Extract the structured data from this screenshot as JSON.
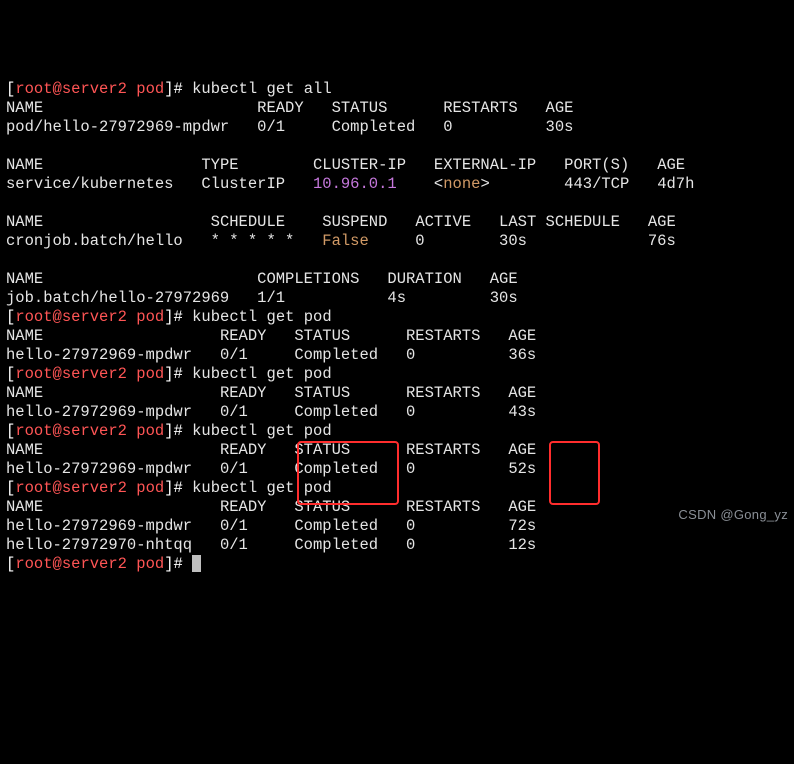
{
  "prompt": {
    "user": "root",
    "host": "server2",
    "cwd": "pod",
    "open": "[",
    "at": "@",
    "close": "]",
    "hash": "# "
  },
  "cmds": {
    "get_all": "kubectl get all",
    "get_pod": "kubectl get pod"
  },
  "hdrs": {
    "NAME": "NAME",
    "READY": "READY",
    "STATUS": "STATUS",
    "RESTARTS": "RESTARTS",
    "AGE": "AGE",
    "TYPE": "TYPE",
    "CLUSTER_IP": "CLUSTER-IP",
    "EXTERNAL_IP": "EXTERNAL-IP",
    "PORTS": "PORT(S)",
    "SCHEDULE": "SCHEDULE",
    "SUSPEND": "SUSPEND",
    "ACTIVE": "ACTIVE",
    "LAST_SCHEDULE": "LAST SCHEDULE",
    "COMPLETIONS": "COMPLETIONS",
    "DURATION": "DURATION"
  },
  "block1_pod": {
    "name": "pod/hello-27972969-mpdwr",
    "ready": "0/1",
    "status": "Completed",
    "restarts": "0",
    "age": "30s"
  },
  "svc": {
    "name": "service/kubernetes",
    "type": "ClusterIP",
    "cluster_ip": "10.96.0.1",
    "external_ip_open": "<",
    "external_ip_text": "none",
    "external_ip_close": ">",
    "ports": "443/TCP",
    "age": "4d7h"
  },
  "cron": {
    "name": "cronjob.batch/hello",
    "schedule": "* * * * *",
    "suspend": "False",
    "active": "0",
    "last": "30s",
    "age": "76s"
  },
  "job": {
    "name": "job.batch/hello-27972969",
    "completions": "1/1",
    "duration": "4s",
    "age": "30s"
  },
  "pods_runs": [
    {
      "rows": [
        {
          "name": "hello-27972969-mpdwr",
          "ready": "0/1",
          "status": "Completed",
          "restarts": "0",
          "age": "36s"
        }
      ]
    },
    {
      "rows": [
        {
          "name": "hello-27972969-mpdwr",
          "ready": "0/1",
          "status": "Completed",
          "restarts": "0",
          "age": "43s"
        }
      ]
    },
    {
      "rows": [
        {
          "name": "hello-27972969-mpdwr",
          "ready": "0/1",
          "status": "Completed",
          "restarts": "0",
          "age": "52s"
        }
      ]
    },
    {
      "rows": [
        {
          "name": "hello-27972969-mpdwr",
          "ready": "0/1",
          "status": "Completed",
          "restarts": "0",
          "age": "72s"
        },
        {
          "name": "hello-27972970-nhtqq",
          "ready": "0/1",
          "status": "Completed",
          "restarts": "0",
          "age": "12s"
        }
      ]
    }
  ],
  "watermark": "CSDN @Gong_yz"
}
